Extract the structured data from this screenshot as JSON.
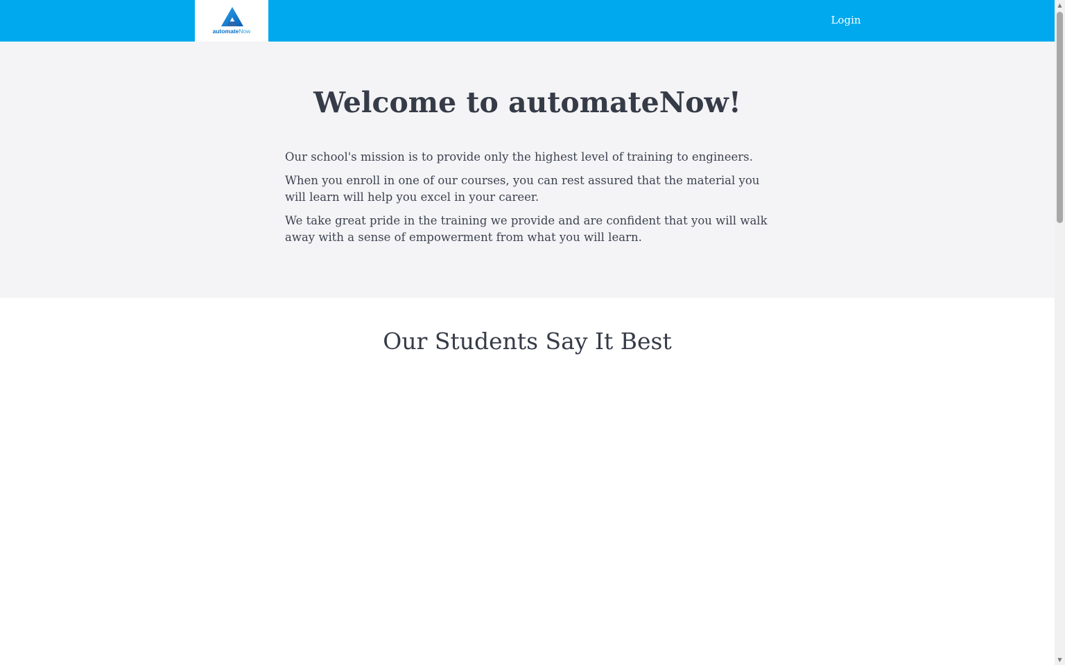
{
  "header": {
    "logo": {
      "brand_part1": "automate",
      "brand_part2": "Now",
      "icon": "automatenow-logo-icon"
    },
    "login_label": "Login"
  },
  "hero": {
    "title": "Welcome to automateNow!",
    "paragraphs": [
      "Our school's mission is to provide only the highest level of training to engineers.",
      "When you enroll in one of our courses, you can rest assured that the material you will learn will help you excel in your career.",
      "We take great pride in the training we provide and are confident that you will walk away with a sense of empowerment from what you will learn."
    ]
  },
  "testimonials": {
    "title": "Our Students Say It Best"
  },
  "colors": {
    "nav_background": "#00a9ed",
    "hero_background": "#f4f4f6",
    "heading_text": "#353b47"
  }
}
